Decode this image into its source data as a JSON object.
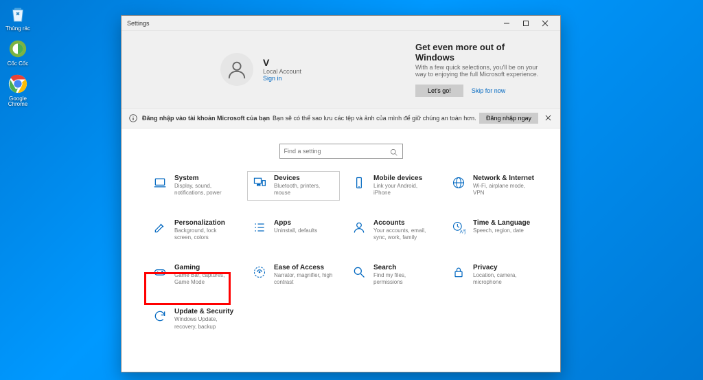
{
  "desktop": {
    "icons": [
      {
        "name": "recycle-bin-icon",
        "label": "Thùng rác"
      },
      {
        "name": "coccoc-icon",
        "label": "Cốc Cốc"
      },
      {
        "name": "chrome-icon",
        "label": "Google Chrome"
      }
    ]
  },
  "window": {
    "title": "Settings"
  },
  "profile": {
    "name": "V",
    "account_type": "Local Account",
    "sign_in": "Sign in"
  },
  "promo": {
    "title": "Get even more out of Windows",
    "subtitle": "With a few quick selections, you'll be on your way to enjoying the full Microsoft experience.",
    "lets_go": "Let's go!",
    "skip": "Skip for now"
  },
  "banner": {
    "bold": "Đăng nhập vào tài khoản Microsoft của bạn",
    "rest": "Bạn sẽ có thể sao lưu các tệp và ảnh của mình để giữ chúng an toàn hơn.",
    "login_btn": "Đăng nhập ngay"
  },
  "search": {
    "placeholder": "Find a setting"
  },
  "tiles": [
    {
      "icon": "laptop-icon",
      "label": "System",
      "desc": "Display, sound, notifications, power"
    },
    {
      "icon": "devices-icon",
      "label": "Devices",
      "desc": "Bluetooth, printers, mouse",
      "hover": true
    },
    {
      "icon": "phone-icon",
      "label": "Mobile devices",
      "desc": "Link your Android, iPhone"
    },
    {
      "icon": "globe-icon",
      "label": "Network & Internet",
      "desc": "Wi-Fi, airplane mode, VPN"
    },
    {
      "icon": "paint-icon",
      "label": "Personalization",
      "desc": "Background, lock screen, colors"
    },
    {
      "icon": "apps-icon",
      "label": "Apps",
      "desc": "Uninstall, defaults"
    },
    {
      "icon": "person-icon",
      "label": "Accounts",
      "desc": "Your accounts, email, sync, work, family"
    },
    {
      "icon": "clock-lang-icon",
      "label": "Time & Language",
      "desc": "Speech, region, date"
    },
    {
      "icon": "gaming-icon",
      "label": "Gaming",
      "desc": "Game Bar, captures, Game Mode"
    },
    {
      "icon": "ease-icon",
      "label": "Ease of Access",
      "desc": "Narrator, magnifier, high contrast"
    },
    {
      "icon": "search-cat-icon",
      "label": "Search",
      "desc": "Find my files, permissions"
    },
    {
      "icon": "lock-icon",
      "label": "Privacy",
      "desc": "Location, camera, microphone"
    },
    {
      "icon": "update-icon",
      "label": "Update & Security",
      "desc": "Windows Update, recovery, backup"
    }
  ]
}
